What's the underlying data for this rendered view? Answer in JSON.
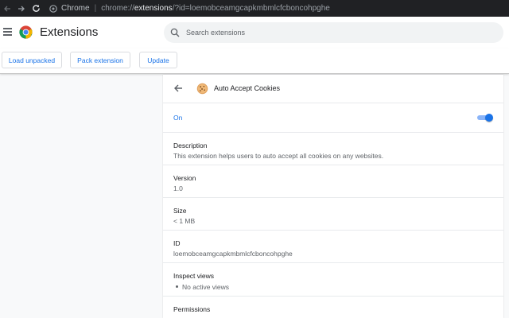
{
  "browser": {
    "omnibox_chip": "Chrome",
    "url_scheme": "chrome://",
    "url_host": "extensions",
    "url_path": "/?id=loemobceamgcapkmbmlcfcboncohpghe"
  },
  "header": {
    "title": "Extensions",
    "search_placeholder": "Search extensions"
  },
  "toolbar": {
    "load_unpacked": "Load unpacked",
    "pack_extension": "Pack extension",
    "update": "Update"
  },
  "detail": {
    "name": "Auto Accept Cookies",
    "status": "On",
    "enabled": true,
    "description_label": "Description",
    "description": "This extension helps users to auto accept all cookies on any websites.",
    "version_label": "Version",
    "version": "1.0",
    "size_label": "Size",
    "size": "< 1 MB",
    "id_label": "ID",
    "id": "loemobceamgcapkmbmlcfcboncohpghe",
    "inspect_label": "Inspect views",
    "inspect_value": "No active views",
    "permissions_label": "Permissions"
  },
  "colors": {
    "accent": "#1a73e8",
    "omnibar_bg": "#202124"
  }
}
